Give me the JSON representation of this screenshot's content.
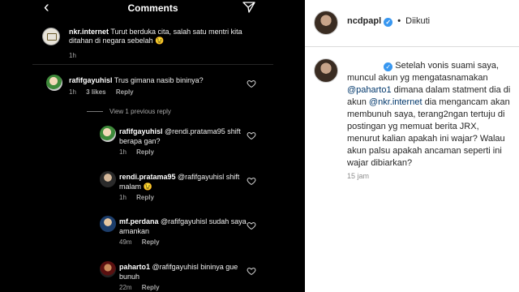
{
  "comments_panel": {
    "title": "Comments",
    "caption": {
      "username": "nkr.internet",
      "text": "Turut berduka cita, salah satu mentri kita ditahan di negara sebelah 😉",
      "time": "1h"
    },
    "comment": {
      "username": "rafifgayuhisl",
      "text": "Trus gimana nasib bininya?",
      "time": "1h",
      "likes": "3 likes",
      "reply": "Reply"
    },
    "view_previous": "View 1 previous reply",
    "replies": [
      {
        "username": "rafifgayuhisl",
        "mention": "@rendi.pratama95",
        "text": "shift berapa gan?",
        "time": "1h",
        "reply": "Reply"
      },
      {
        "username": "rendi.pratama95",
        "mention": "@rafifgayuhisl",
        "text": "shift malam 😉",
        "time": "1h",
        "reply": "Reply"
      },
      {
        "username": "mf.perdana",
        "mention": "@rafifgayuhisl",
        "text": "sudah saya amankan",
        "time": "49m",
        "reply": "Reply"
      },
      {
        "username": "paharto1",
        "mention": "@rafifgayuhisl",
        "text": "bininya gue bunuh",
        "time": "22m",
        "reply": "Reply"
      }
    ]
  },
  "post_panel": {
    "username": "ncdpapl",
    "separator": "•",
    "follow_status": "Diikuti",
    "caption_parts": [
      "Setelah vonis suami saya, muncul akun yg mengatasnamakan ",
      "@paharto1",
      " dimana dalam statment dia di akun ",
      "@nkr.internet",
      " dia mengancam akan membunuh saya, terang2ngan tertuju di postingan yg memuat berita JRX, menurut kalian apakah ini wajar? Walau akun palsu apakah ancaman seperti ini wajar dibiarkan?"
    ],
    "time": "15 jam"
  },
  "colors": {
    "accent": "#3897f0",
    "mention": "#00376b",
    "muted": "#a8a8a8"
  },
  "icons": [
    "back-icon",
    "send-icon",
    "heart-icon",
    "verified-icon"
  ]
}
